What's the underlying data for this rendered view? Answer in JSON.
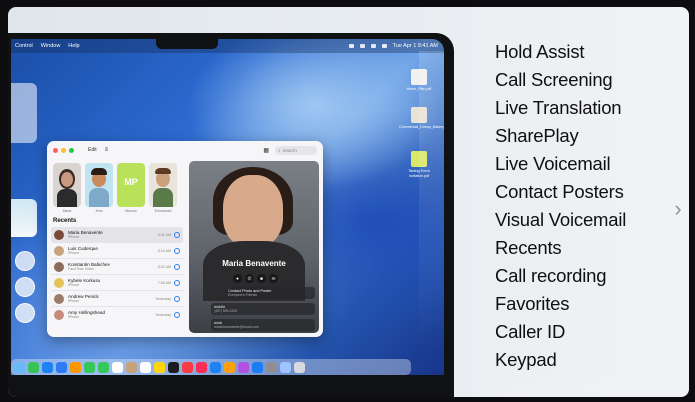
{
  "menubar": {
    "items": [
      "Control",
      "Window",
      "Help"
    ],
    "clock": "Tue Apr 1  9:41 AM"
  },
  "desktop_files": [
    {
      "name": "Home_Plan.pdf",
      "color": "#f1f1f1"
    },
    {
      "name": "Commercial_Lineup_Bakery.pdf",
      "color": "#e9e2d6"
    },
    {
      "name": "Tasting Event Invitation.pdf",
      "color": "#d9e86a"
    }
  ],
  "phone": {
    "edit_label": "Edit",
    "search_placeholder": "Search",
    "favorites": [
      {
        "name": "Maria",
        "color": "#d9d4cf"
      },
      {
        "name": "Jess",
        "color": "#bfe3ef"
      },
      {
        "name": "Marcus",
        "color": "#b9e25a",
        "initials": "MP"
      },
      {
        "name": "Emmanuel",
        "color": "#e9e4dc"
      }
    ],
    "recents_title": "Recents",
    "recents": [
      {
        "name": "Maria Benavente",
        "sub": "iPhone",
        "time": "9:41 AM",
        "color": "#7a4a3a"
      },
      {
        "name": "Luis Cuderque",
        "sub": "iPhone",
        "time": "8:10 AM",
        "color": "#c7a27d"
      },
      {
        "name": "Konstantin Babichev",
        "sub": "FaceTime Video",
        "time": "8:02 AM",
        "color": "#8d6b5a"
      },
      {
        "name": "Kybele Korkusu",
        "sub": "iPhone",
        "time": "7:58 AM",
        "color": "#e3c35a"
      },
      {
        "name": "Andrew Penick",
        "sub": "iPhone",
        "time": "Yesterday",
        "color": "#9b7b6a"
      },
      {
        "name": "Amy Hollingshead",
        "sub": "iPhone",
        "time": "Yesterday",
        "color": "#c78a7a"
      }
    ],
    "poster": {
      "name": "Maria Benavente",
      "cards": [
        {
          "line1": "Contact Photo and Poster",
          "line2": "Everyone's Friends"
        },
        {
          "line1": "mobile",
          "line2": "(407) 555-0190"
        },
        {
          "line1": "work",
          "line2": "maria.benavente@icloud.com"
        }
      ]
    }
  },
  "dock_colors": [
    "#6ab8f4",
    "#39c256",
    "#1e82f3",
    "#2f7bf6",
    "#ff9500",
    "#34c759",
    "#ffffff",
    "#ff3b30",
    "#ffffff",
    "#ffd60a",
    "#1c1c1e",
    "#fc3c44",
    "#ff2d55",
    "#1e82f3",
    "#ff9f0a",
    "#fa233b",
    "#1b7cf5",
    "#8e8e93",
    "#1e82f3",
    "#a0c4ff"
  ],
  "features": [
    "Hold Assist",
    "Call Screening",
    "Live Translation",
    "SharePlay",
    "Live Voicemail",
    "Contact Posters",
    "Visual Voicemail",
    "Recents",
    "Call recording",
    "Favorites",
    "Caller ID",
    "Keypad"
  ],
  "next_glyph": "›"
}
